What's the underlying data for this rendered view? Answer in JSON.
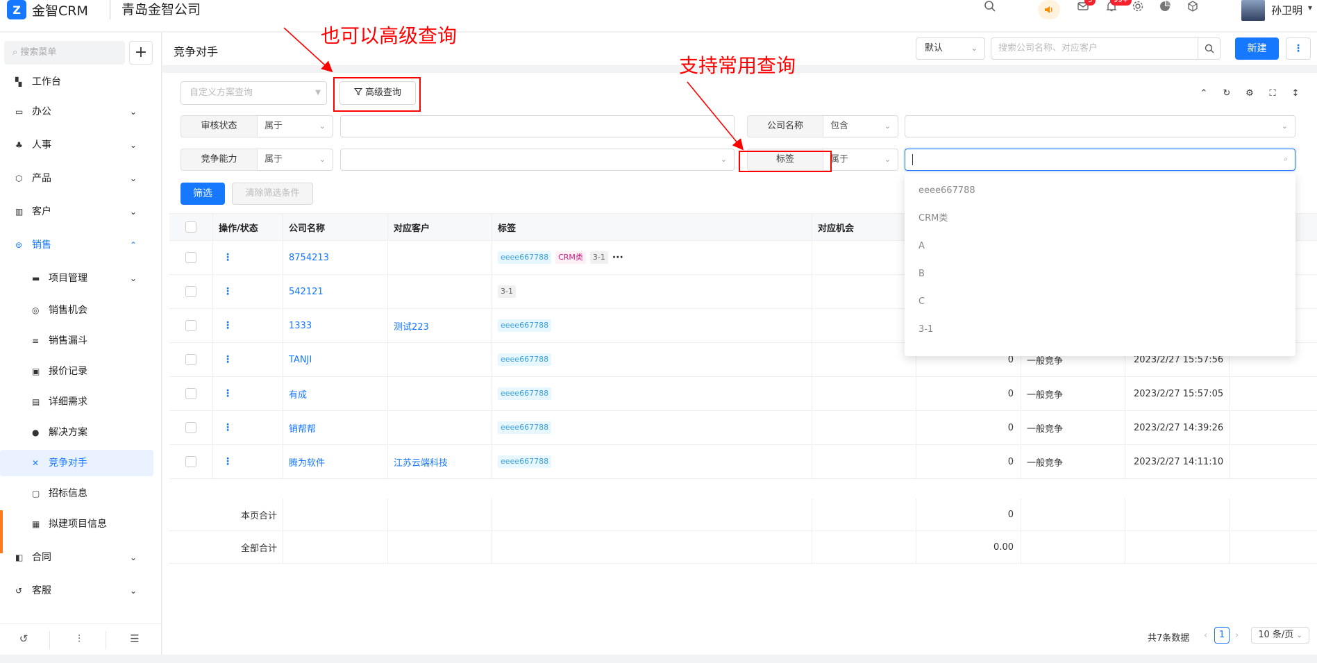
{
  "app": {
    "name": "金智CRM",
    "company": "青岛金智公司",
    "logo_mark": "Z"
  },
  "topbar": {
    "icons": [
      "search-icon",
      "speaker-icon",
      "message-icon",
      "bell-icon",
      "gear-icon",
      "pie-chart-icon",
      "cube-icon"
    ],
    "message_badge": "3",
    "bell_badge": "99+",
    "user": "孙卫明"
  },
  "sidebar": {
    "search_placeholder": "搜索菜单",
    "items": [
      {
        "label": "工作台",
        "icon": "dashboard-icon"
      },
      {
        "label": "办公",
        "icon": "monitor-icon"
      },
      {
        "label": "人事",
        "icon": "people-icon"
      },
      {
        "label": "产品",
        "icon": "box-icon"
      },
      {
        "label": "客户",
        "icon": "bar-chart-icon"
      },
      {
        "label": "销售",
        "icon": "sales-icon"
      },
      {
        "label": "项目管理",
        "icon": "folder-icon"
      },
      {
        "label": "销售机会",
        "icon": "target-icon"
      },
      {
        "label": "销售漏斗",
        "icon": "funnel-icon"
      },
      {
        "label": "报价记录",
        "icon": "quote-icon"
      },
      {
        "label": "详细需求",
        "icon": "document-icon"
      },
      {
        "label": "解决方案",
        "icon": "bulb-icon"
      },
      {
        "label": "竞争对手",
        "icon": "sword-icon"
      },
      {
        "label": "招标信息",
        "icon": "bid-icon"
      },
      {
        "label": "拟建项目信息",
        "icon": "plan-icon"
      },
      {
        "label": "合同",
        "icon": "contract-icon"
      },
      {
        "label": "客服",
        "icon": "service-icon"
      }
    ],
    "bottom_icons": [
      "history-icon",
      "settings-sliders-icon",
      "collapse-icon"
    ]
  },
  "header": {
    "title": "竞争对手",
    "view": "默认",
    "search_placeholder": "搜索公司名称、对应客户",
    "new_label": "新建"
  },
  "filters": {
    "scheme_placeholder": "自定义方案查询",
    "advanced_label": "高级查询",
    "rows": [
      {
        "label": "审核状态",
        "op": "属于"
      },
      {
        "label": "公司名称",
        "op": "包含"
      },
      {
        "label": "竞争能力",
        "op": "属于"
      },
      {
        "label": "标签",
        "op": "属于"
      }
    ],
    "filter_label": "筛选",
    "clear_label": "清除筛选条件"
  },
  "table": {
    "columns": [
      "操作/状态",
      "公司名称",
      "对应客户",
      "标签",
      "对应机会"
    ],
    "rows": [
      {
        "company": "8754213",
        "customer": "",
        "tags": [
          "eeee667788",
          "CRM类",
          "3-1"
        ],
        "more": true,
        "count": "",
        "level": "",
        "time": ""
      },
      {
        "company": "542121",
        "customer": "",
        "tags": [
          "3-1"
        ],
        "more": false,
        "count": "",
        "level": "",
        "time": ""
      },
      {
        "company": "1333",
        "customer": "测试223",
        "tags": [
          "eeee667788"
        ],
        "more": false,
        "count": "",
        "level": "",
        "time": ""
      },
      {
        "company": "TANJI",
        "customer": "",
        "tags": [
          "eeee667788"
        ],
        "more": false,
        "count": "0",
        "level": "一般竞争",
        "time": "2023/2/27 15:57:56"
      },
      {
        "company": "有成",
        "customer": "",
        "tags": [
          "eeee667788"
        ],
        "more": false,
        "count": "0",
        "level": "一般竞争",
        "time": "2023/2/27 15:57:05"
      },
      {
        "company": "销帮帮",
        "customer": "",
        "tags": [
          "eeee667788"
        ],
        "more": false,
        "count": "0",
        "level": "一般竞争",
        "time": "2023/2/27 14:39:26"
      },
      {
        "company": "腾为软件",
        "customer": "江苏云端科技",
        "tags": [
          "eeee667788"
        ],
        "more": false,
        "count": "0",
        "level": "一般竞争",
        "time": "2023/2/27 14:11:10"
      }
    ],
    "page_total_label": "本页合计",
    "page_total_value": "0",
    "all_total_label": "全部合计",
    "all_total_value": "0.00"
  },
  "tag_dropdown": [
    "eeee667788",
    "CRM类",
    "A",
    "B",
    "C",
    "3-1"
  ],
  "pagination": {
    "summary": "共7条数据",
    "current": "1",
    "page_size": "10 条/页"
  },
  "annotations": {
    "advanced": "也可以高级查询",
    "common": "支持常用查询"
  },
  "colors": {
    "primary": "#1677ff",
    "annotation": "#ff0000",
    "tag_cyan": "#3aa0d8",
    "tag_pink": "#c41d7f"
  }
}
